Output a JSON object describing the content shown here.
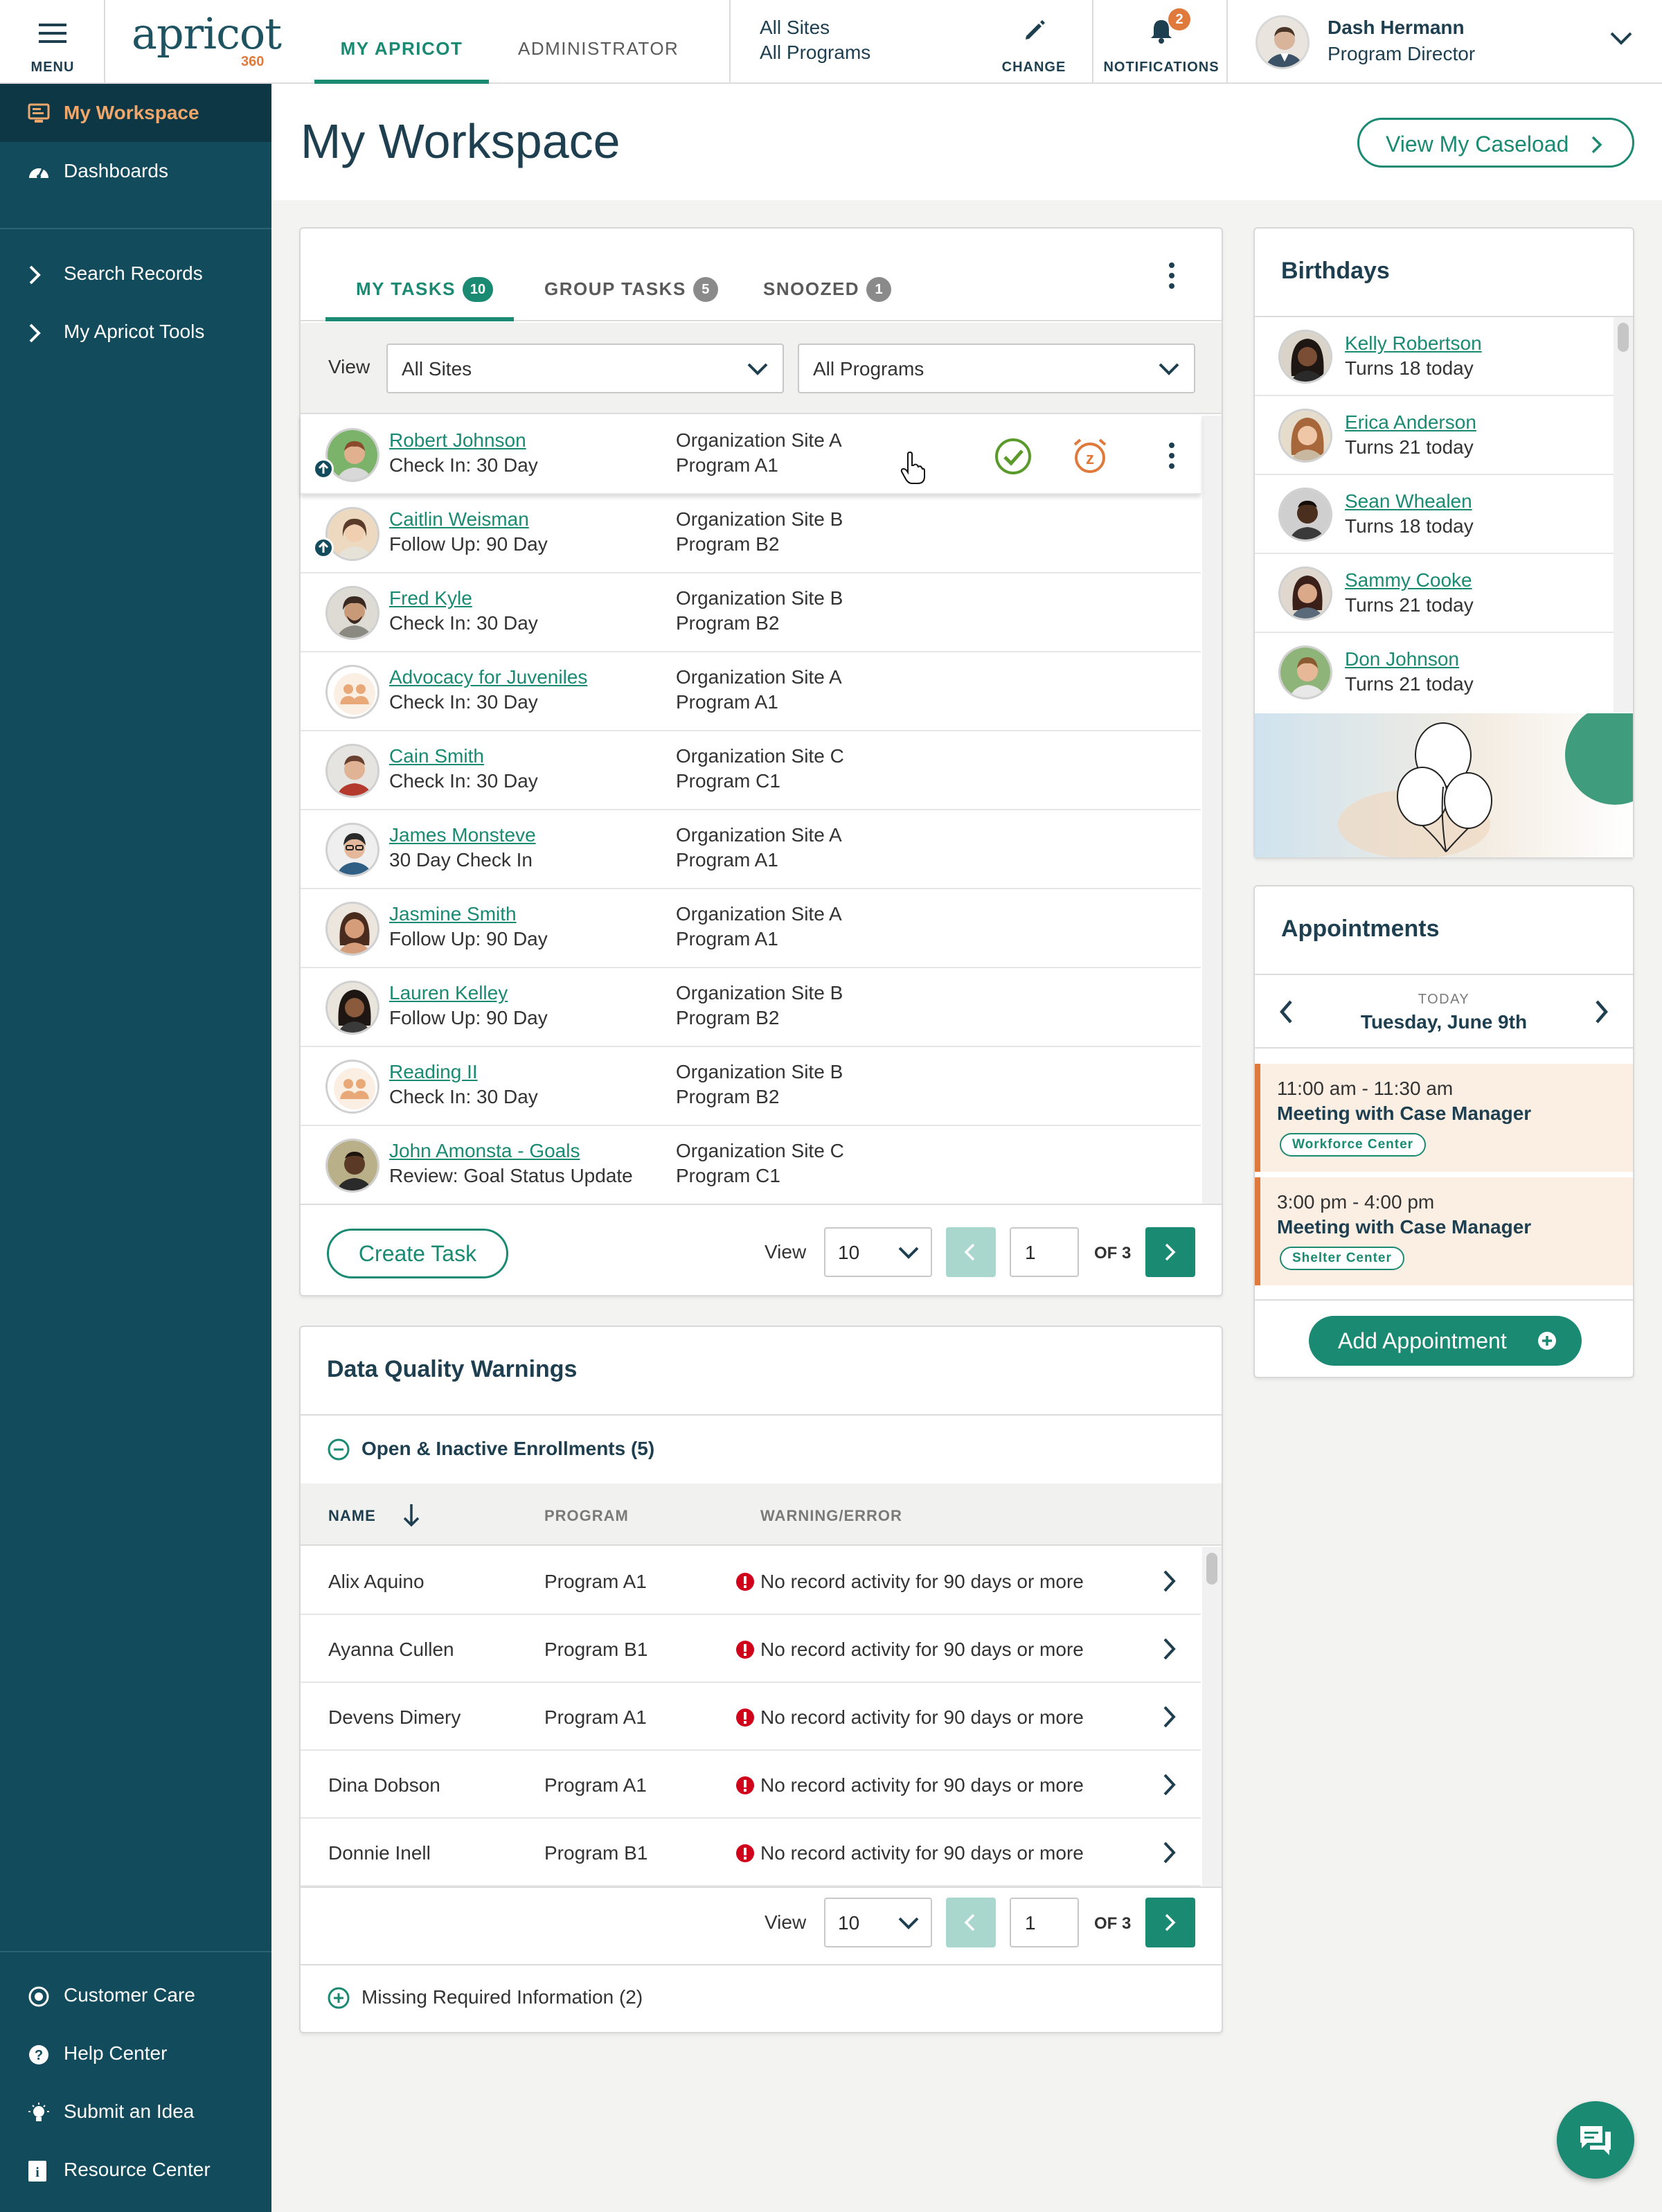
{
  "topbar": {
    "menu_label": "MENU",
    "logo_text": "apricot",
    "logo_sub": "360",
    "tabs": [
      {
        "label": "MY APRICOT"
      },
      {
        "label": "ADMINISTRATOR"
      }
    ],
    "site_selector": {
      "sites": "All Sites",
      "programs": "All Programs"
    },
    "change_label": "CHANGE",
    "notifications": {
      "label": "NOTIFICATIONS",
      "count": "2"
    },
    "user": {
      "name": "Dash Hermann",
      "role": "Program Director"
    }
  },
  "sidebar": {
    "items": [
      {
        "label": "My Workspace",
        "icon": "workspace-icon"
      },
      {
        "label": "Dashboards",
        "icon": "dashboard-icon"
      },
      {
        "label": "Search Records",
        "icon": "chevron-right-icon"
      },
      {
        "label": "My Apricot Tools",
        "icon": "chevron-right-icon"
      }
    ],
    "bottom_items": [
      {
        "label": "Customer Care",
        "icon": "headset-icon"
      },
      {
        "label": "Help Center",
        "icon": "help-icon"
      },
      {
        "label": "Submit an Idea",
        "icon": "lightbulb-icon"
      },
      {
        "label": "Resource Center",
        "icon": "info-icon"
      }
    ]
  },
  "page": {
    "title": "My Workspace",
    "caseload_button": "View My Caseload"
  },
  "tasks": {
    "tabs": [
      {
        "label": "MY TASKS",
        "count": "10"
      },
      {
        "label": "GROUP TASKS",
        "count": "5"
      },
      {
        "label": "SNOOZED",
        "count": "1"
      }
    ],
    "view_label": "View",
    "site_filter": "All Sites",
    "program_filter": "All Programs",
    "rows": [
      {
        "name": "Robert Johnson",
        "type": "Check In: 30 Day",
        "site": "Organization Site A",
        "program": "Program A1"
      },
      {
        "name": "Caitlin Weisman",
        "type": "Follow Up: 90 Day",
        "site": "Organization Site B",
        "program": "Program B2"
      },
      {
        "name": "Fred Kyle",
        "type": "Check In: 30 Day",
        "site": "Organization Site B",
        "program": "Program B2"
      },
      {
        "name": "Advocacy for Juveniles",
        "type": "Check In: 30 Day",
        "site": "Organization Site A",
        "program": "Program A1"
      },
      {
        "name": "Cain Smith",
        "type": "Check In: 30 Day",
        "site": "Organization Site C",
        "program": "Program C1"
      },
      {
        "name": "James Monsteve",
        "type": "30 Day Check In",
        "site": "Organization Site A",
        "program": "Program A1"
      },
      {
        "name": "Jasmine Smith",
        "type": "Follow Up: 90 Day",
        "site": "Organization Site A",
        "program": "Program A1"
      },
      {
        "name": "Lauren Kelley",
        "type": "Follow Up: 90 Day",
        "site": "Organization Site B",
        "program": "Program B2"
      },
      {
        "name": "Reading II",
        "type": "Check In: 30 Day",
        "site": "Organization Site B",
        "program": "Program B2"
      },
      {
        "name": "John Amonsta - Goals",
        "type": "Review: Goal Status Update",
        "site": "Organization Site C",
        "program": "Program C1"
      }
    ],
    "create_button": "Create Task",
    "pager": {
      "view_label": "View",
      "per_page": "10",
      "page": "1",
      "of": "OF 3"
    }
  },
  "data_quality": {
    "title": "Data Quality Warnings",
    "section_open": "Open & Inactive Enrollments (5)",
    "columns": {
      "name": "NAME",
      "program": "PROGRAM",
      "warning": "WARNING/ERROR"
    },
    "rows": [
      {
        "name": "Alix Aquino",
        "program": "Program A1",
        "warning": "No record activity for 90 days or more"
      },
      {
        "name": "Ayanna Cullen",
        "program": "Program B1",
        "warning": "No record activity for 90 days or more"
      },
      {
        "name": "Devens Dimery",
        "program": "Program A1",
        "warning": "No record activity for 90 days or more"
      },
      {
        "name": "Dina Dobson",
        "program": "Program A1",
        "warning": "No record activity for 90 days or more"
      },
      {
        "name": "Donnie Inell",
        "program": "Program B1",
        "warning": "No record activity for 90 days or more"
      }
    ],
    "pager": {
      "view_label": "View",
      "per_page": "10",
      "page": "1",
      "of": "OF 3"
    },
    "section_closed": "Missing Required Information (2)"
  },
  "birthdays": {
    "title": "Birthdays",
    "items": [
      {
        "name": "Kelly Robertson",
        "note": "Turns 18 today"
      },
      {
        "name": "Erica Anderson",
        "note": "Turns 21 today"
      },
      {
        "name": "Sean Whealen",
        "note": "Turns 18 today"
      },
      {
        "name": "Sammy Cooke",
        "note": "Turns 21 today"
      },
      {
        "name": "Don Johnson",
        "note": "Turns 21 today"
      }
    ]
  },
  "appointments": {
    "title": "Appointments",
    "day_label": "TODAY",
    "date": "Tuesday, June 9th",
    "items": [
      {
        "time": "11:00 am - 11:30 am",
        "title": "Meeting with Case Manager",
        "tag": "Workforce Center"
      },
      {
        "time": "3:00 pm - 4:00 pm",
        "title": "Meeting with Case Manager",
        "tag": "Shelter Center"
      }
    ],
    "add_button": "Add Appointment"
  },
  "colors": {
    "brand": "#114b5c",
    "accent": "#1b8a73",
    "highlight": "#e07a3c",
    "error": "#d0021b"
  }
}
